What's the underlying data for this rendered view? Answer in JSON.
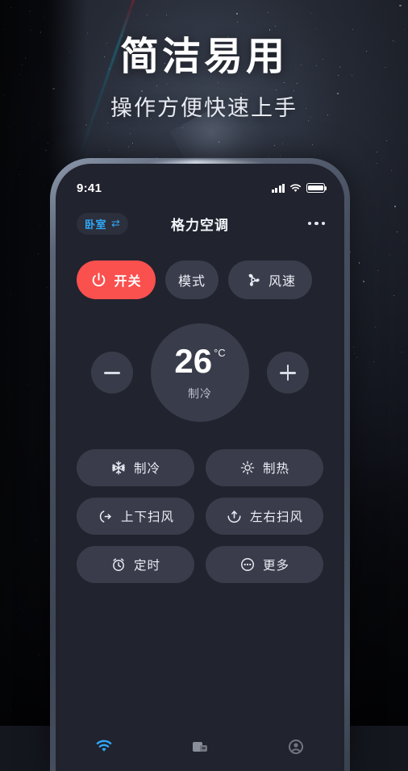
{
  "promo": {
    "headline": "简洁易用",
    "subhead": "操作方便快速上手"
  },
  "colors": {
    "accent_red": "#fa504e",
    "accent_blue": "#2fa8f7",
    "screen_bg": "#21232e",
    "button_bg": "#3a3c4c"
  },
  "phone": {
    "statusbar": {
      "time": "9:41",
      "signal_icon": "signal-bars-icon",
      "wifi_icon": "wifi-icon",
      "battery_icon": "battery-icon"
    },
    "header": {
      "room_label": "卧室",
      "room_swap_icon": "⇄",
      "device_title": "格力空调",
      "more_icon": "ellipsis-icon"
    },
    "actions": [
      {
        "label": "开关",
        "icon": "power-icon",
        "active": true
      },
      {
        "label": "模式",
        "icon": "none",
        "active": false
      },
      {
        "label": "风速",
        "icon": "fan-icon",
        "active": false
      }
    ],
    "thermostat": {
      "decrease_label": "−",
      "decrease_icon": "minus-icon",
      "increase_label": "+",
      "increase_icon": "plus-icon",
      "temperature": "26",
      "unit": "°C",
      "mode_label": "制冷"
    },
    "functions": [
      {
        "label": "制冷",
        "icon": "snowflake-icon"
      },
      {
        "label": "制热",
        "icon": "sun-icon"
      },
      {
        "label": "上下扫风",
        "icon": "swing-vertical-icon"
      },
      {
        "label": "左右扫风",
        "icon": "swing-horizontal-icon"
      },
      {
        "label": "定时",
        "icon": "alarm-clock-icon"
      },
      {
        "label": "更多",
        "icon": "more-circle-icon"
      }
    ],
    "tabs": [
      {
        "icon": "remote-wifi-icon",
        "active": true
      },
      {
        "icon": "devices-icon",
        "active": false
      },
      {
        "icon": "profile-icon",
        "active": false
      }
    ]
  }
}
